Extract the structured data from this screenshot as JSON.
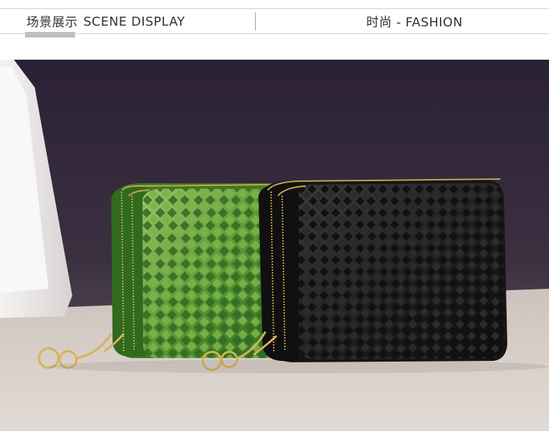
{
  "header": {
    "left_title_cn": "场景展示",
    "left_title_en": "SCENE DISPLAY",
    "right_title": "时尚 - FASHION"
  },
  "photo": {
    "subject": "two woven leather zip card wallets",
    "colors": {
      "backdrop": "#2b2033",
      "surface": "#cfc8c2",
      "green_wallet": "#4f8a2c",
      "black_wallet": "#1a1a1a",
      "zipper": "#c9a54e"
    }
  }
}
